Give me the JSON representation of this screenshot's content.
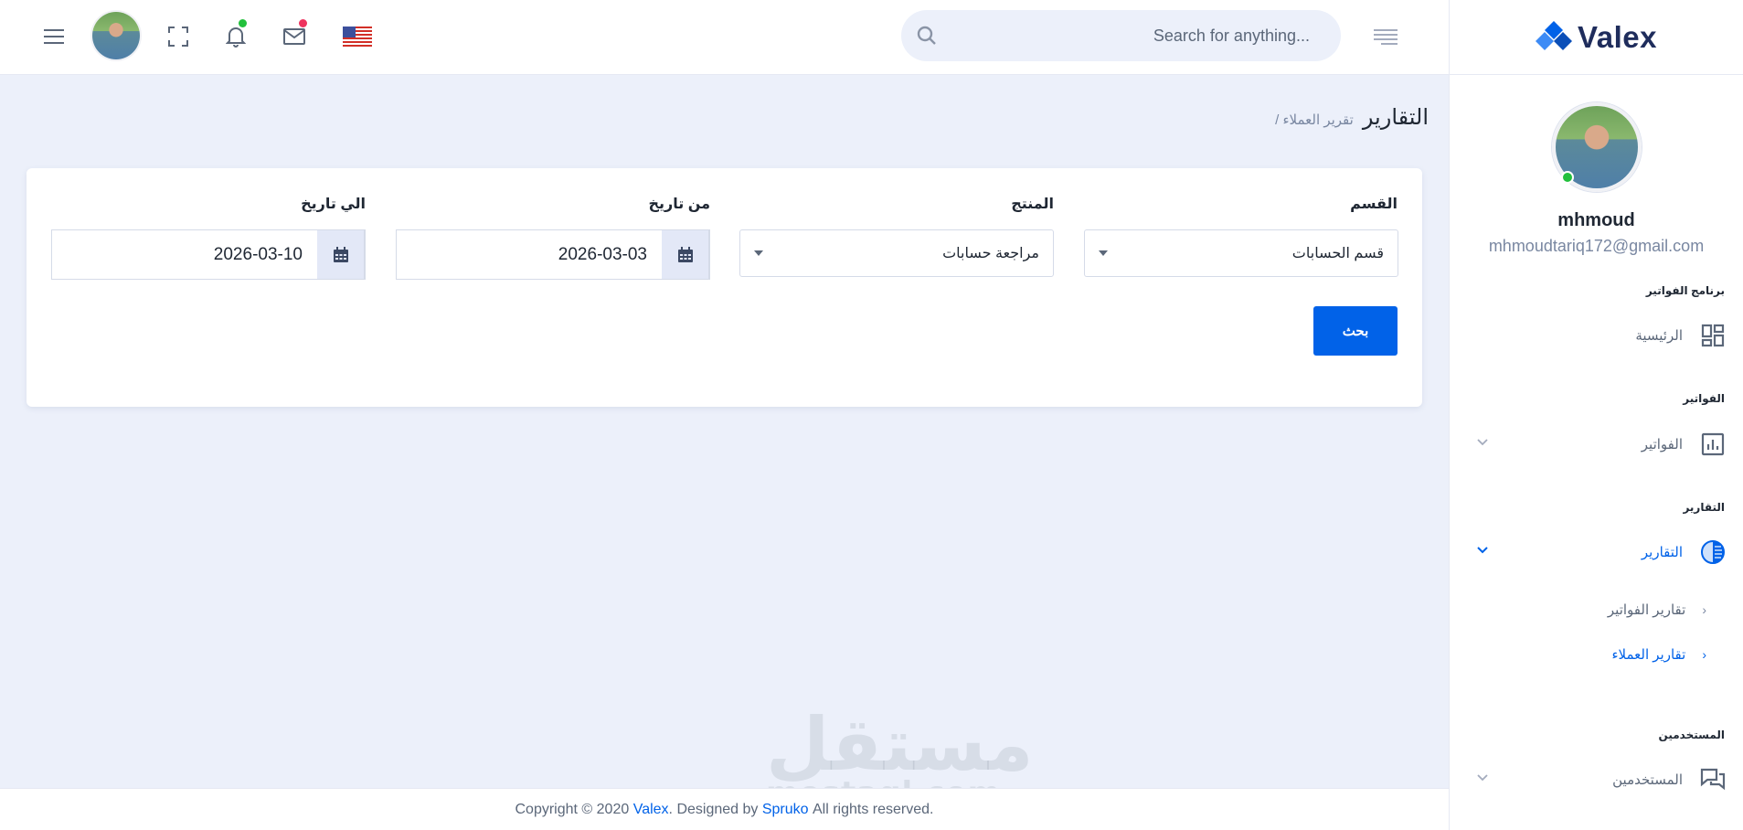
{
  "brand": {
    "name": "Valex"
  },
  "header": {
    "search_placeholder": "Search for anything..."
  },
  "sidebar": {
    "user_name": "mhmoud",
    "user_email": "mhmoudtariq172@gmail.com",
    "categories": {
      "program": "برنامج الفواتير",
      "invoices": "الفواتير",
      "reports": "التقارير",
      "users": "المستخدمين"
    },
    "items": {
      "home": "الرئيسية",
      "invoices": "الفواتير",
      "reports": "التقارير",
      "users": "المستخدمين"
    },
    "sub_items": {
      "invoice_reports": "تقارير الفواتير",
      "customer_reports": "تقارير العملاء"
    }
  },
  "breadcrumb": {
    "title": "التقارير",
    "current": "/ تقرير العملاء"
  },
  "form": {
    "section_label": "القسم",
    "section_value": "قسم الحسابات",
    "product_label": "المنتج",
    "product_value": "مراجعة حسابات",
    "from_label": "من تاريخ",
    "from_value": "2026-03-03",
    "to_label": "الي تاريخ",
    "to_value": "2026-03-10",
    "search_button": "بحث"
  },
  "footer": {
    "prefix": "Copyright © 2020 ",
    "brand_link": "Valex",
    "middle": ". Designed by ",
    "designer_link": "Spruko",
    "suffix": " All rights reserved."
  },
  "watermark": {
    "arabic": "مستقل",
    "latin": "mostaql.com"
  },
  "colors": {
    "primary": "#0162e8",
    "background": "#ecf0fa",
    "online": "#22c03c",
    "notify": "#ee335e"
  },
  "icons": [
    "menu-icon",
    "fullscreen-icon",
    "bell-icon",
    "mail-icon",
    "us-flag-icon",
    "search-icon",
    "sidebar-toggle-icon",
    "dashboard-icon",
    "chart-icon",
    "pie-icon",
    "chat-icon",
    "calendar-icon",
    "chevron-down-icon"
  ]
}
